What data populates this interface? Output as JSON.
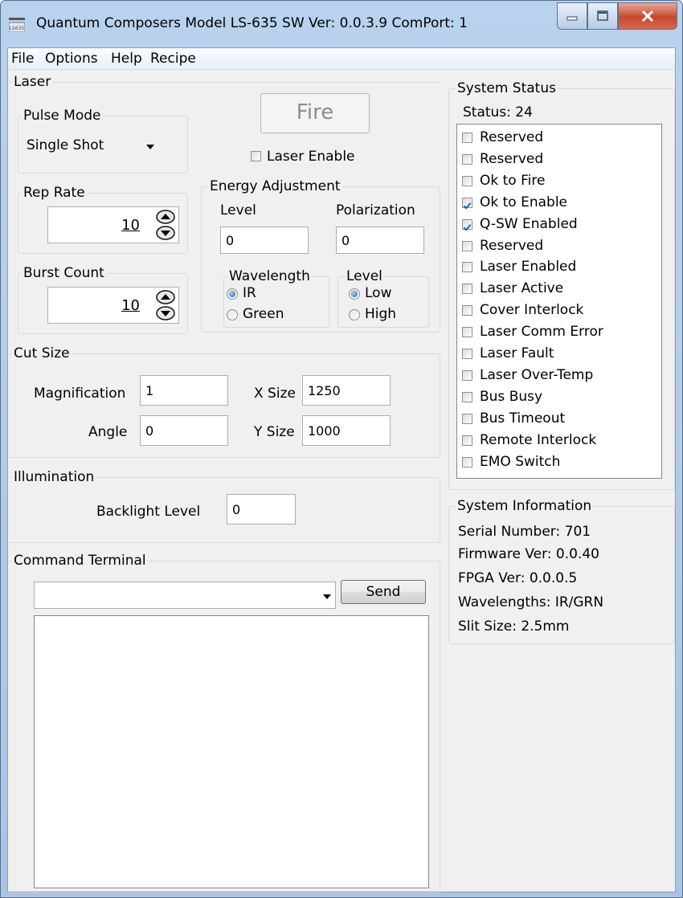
{
  "window": {
    "title": "Quantum Composers Model LS-635  SW Ver: 0.0.3.9 ComPort: 1",
    "app_icon_text": "LS635"
  },
  "menu": {
    "file": "File",
    "options": "Options",
    "help": "Help",
    "recipe": "Recipe"
  },
  "laser": {
    "legend": "Laser",
    "pulse_mode": {
      "legend": "Pulse Mode",
      "value": "Single Shot"
    },
    "rep_rate": {
      "legend": "Rep Rate",
      "value": "10"
    },
    "burst_count": {
      "legend": "Burst Count",
      "value": "10"
    },
    "fire_label": "Fire",
    "laser_enable_label": "Laser Enable",
    "laser_enable_checked": false,
    "energy": {
      "legend": "Energy Adjustment",
      "level_label": "Level",
      "level_value": "0",
      "polarization_label": "Polarization",
      "polarization_value": "0",
      "wavelength": {
        "legend": "Wavelength",
        "options": [
          "IR",
          "Green"
        ],
        "selected": "IR"
      },
      "level_group": {
        "legend": "Level",
        "options": [
          "Low",
          "High"
        ],
        "selected": "Low"
      }
    }
  },
  "cut_size": {
    "legend": "Cut Size",
    "magnification_label": "Magnification",
    "magnification_value": "1",
    "angle_label": "Angle",
    "angle_value": "0",
    "x_size_label": "X Size",
    "x_size_value": "1250",
    "y_size_label": "Y Size",
    "y_size_value": "1000"
  },
  "illumination": {
    "legend": "Illumination",
    "backlight_label": "Backlight Level",
    "backlight_value": "0"
  },
  "command_terminal": {
    "legend": "Command Terminal",
    "command_value": "",
    "send_label": "Send",
    "output": ""
  },
  "system_status": {
    "legend": "System Status",
    "status_text": "Status: 24",
    "flags": [
      {
        "label": "Reserved",
        "checked": false
      },
      {
        "label": "Reserved",
        "checked": false
      },
      {
        "label": "Ok to Fire",
        "checked": false
      },
      {
        "label": "Ok to Enable",
        "checked": true
      },
      {
        "label": "Q-SW Enabled",
        "checked": true
      },
      {
        "label": "Reserved",
        "checked": false
      },
      {
        "label": "Laser Enabled",
        "checked": false
      },
      {
        "label": "Laser Active",
        "checked": false
      },
      {
        "label": "Cover Interlock",
        "checked": false
      },
      {
        "label": "Laser Comm Error",
        "checked": false
      },
      {
        "label": "Laser Fault",
        "checked": false
      },
      {
        "label": "Laser Over-Temp",
        "checked": false
      },
      {
        "label": "Bus Busy",
        "checked": false
      },
      {
        "label": "Bus Timeout",
        "checked": false
      },
      {
        "label": "Remote Interlock",
        "checked": false
      },
      {
        "label": "EMO Switch",
        "checked": false
      }
    ]
  },
  "system_info": {
    "legend": "System Information",
    "serial": "Serial Number: 701",
    "firmware": "Firmware Ver: 0.0.40",
    "fpga": "FPGA Ver: 0.0.0.5",
    "wavelengths": "Wavelengths: IR/GRN",
    "slit": "Slit Size: 2.5mm"
  },
  "colors": {
    "close_button": "#c7472c",
    "check_mark": "#1e5fb4",
    "radio_dot": "#1e64a8"
  }
}
